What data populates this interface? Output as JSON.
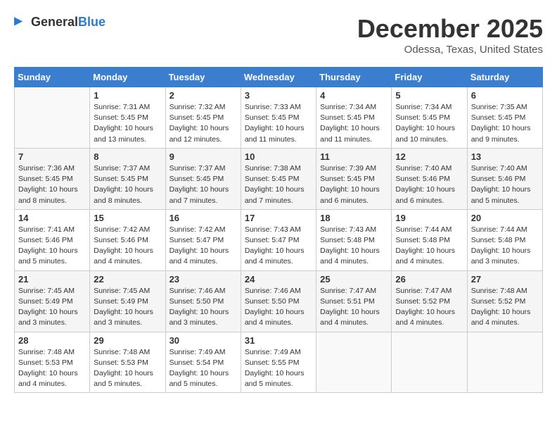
{
  "header": {
    "logo_general": "General",
    "logo_blue": "Blue",
    "month_title": "December 2025",
    "location": "Odessa, Texas, United States"
  },
  "weekdays": [
    "Sunday",
    "Monday",
    "Tuesday",
    "Wednesday",
    "Thursday",
    "Friday",
    "Saturday"
  ],
  "weeks": [
    [
      {
        "day": "",
        "info": ""
      },
      {
        "day": "1",
        "info": "Sunrise: 7:31 AM\nSunset: 5:45 PM\nDaylight: 10 hours\nand 13 minutes."
      },
      {
        "day": "2",
        "info": "Sunrise: 7:32 AM\nSunset: 5:45 PM\nDaylight: 10 hours\nand 12 minutes."
      },
      {
        "day": "3",
        "info": "Sunrise: 7:33 AM\nSunset: 5:45 PM\nDaylight: 10 hours\nand 11 minutes."
      },
      {
        "day": "4",
        "info": "Sunrise: 7:34 AM\nSunset: 5:45 PM\nDaylight: 10 hours\nand 11 minutes."
      },
      {
        "day": "5",
        "info": "Sunrise: 7:34 AM\nSunset: 5:45 PM\nDaylight: 10 hours\nand 10 minutes."
      },
      {
        "day": "6",
        "info": "Sunrise: 7:35 AM\nSunset: 5:45 PM\nDaylight: 10 hours\nand 9 minutes."
      }
    ],
    [
      {
        "day": "7",
        "info": "Sunrise: 7:36 AM\nSunset: 5:45 PM\nDaylight: 10 hours\nand 8 minutes."
      },
      {
        "day": "8",
        "info": "Sunrise: 7:37 AM\nSunset: 5:45 PM\nDaylight: 10 hours\nand 8 minutes."
      },
      {
        "day": "9",
        "info": "Sunrise: 7:37 AM\nSunset: 5:45 PM\nDaylight: 10 hours\nand 7 minutes."
      },
      {
        "day": "10",
        "info": "Sunrise: 7:38 AM\nSunset: 5:45 PM\nDaylight: 10 hours\nand 7 minutes."
      },
      {
        "day": "11",
        "info": "Sunrise: 7:39 AM\nSunset: 5:45 PM\nDaylight: 10 hours\nand 6 minutes."
      },
      {
        "day": "12",
        "info": "Sunrise: 7:40 AM\nSunset: 5:46 PM\nDaylight: 10 hours\nand 6 minutes."
      },
      {
        "day": "13",
        "info": "Sunrise: 7:40 AM\nSunset: 5:46 PM\nDaylight: 10 hours\nand 5 minutes."
      }
    ],
    [
      {
        "day": "14",
        "info": "Sunrise: 7:41 AM\nSunset: 5:46 PM\nDaylight: 10 hours\nand 5 minutes."
      },
      {
        "day": "15",
        "info": "Sunrise: 7:42 AM\nSunset: 5:46 PM\nDaylight: 10 hours\nand 4 minutes."
      },
      {
        "day": "16",
        "info": "Sunrise: 7:42 AM\nSunset: 5:47 PM\nDaylight: 10 hours\nand 4 minutes."
      },
      {
        "day": "17",
        "info": "Sunrise: 7:43 AM\nSunset: 5:47 PM\nDaylight: 10 hours\nand 4 minutes."
      },
      {
        "day": "18",
        "info": "Sunrise: 7:43 AM\nSunset: 5:48 PM\nDaylight: 10 hours\nand 4 minutes."
      },
      {
        "day": "19",
        "info": "Sunrise: 7:44 AM\nSunset: 5:48 PM\nDaylight: 10 hours\nand 4 minutes."
      },
      {
        "day": "20",
        "info": "Sunrise: 7:44 AM\nSunset: 5:48 PM\nDaylight: 10 hours\nand 3 minutes."
      }
    ],
    [
      {
        "day": "21",
        "info": "Sunrise: 7:45 AM\nSunset: 5:49 PM\nDaylight: 10 hours\nand 3 minutes."
      },
      {
        "day": "22",
        "info": "Sunrise: 7:45 AM\nSunset: 5:49 PM\nDaylight: 10 hours\nand 3 minutes."
      },
      {
        "day": "23",
        "info": "Sunrise: 7:46 AM\nSunset: 5:50 PM\nDaylight: 10 hours\nand 3 minutes."
      },
      {
        "day": "24",
        "info": "Sunrise: 7:46 AM\nSunset: 5:50 PM\nDaylight: 10 hours\nand 4 minutes."
      },
      {
        "day": "25",
        "info": "Sunrise: 7:47 AM\nSunset: 5:51 PM\nDaylight: 10 hours\nand 4 minutes."
      },
      {
        "day": "26",
        "info": "Sunrise: 7:47 AM\nSunset: 5:52 PM\nDaylight: 10 hours\nand 4 minutes."
      },
      {
        "day": "27",
        "info": "Sunrise: 7:48 AM\nSunset: 5:52 PM\nDaylight: 10 hours\nand 4 minutes."
      }
    ],
    [
      {
        "day": "28",
        "info": "Sunrise: 7:48 AM\nSunset: 5:53 PM\nDaylight: 10 hours\nand 4 minutes."
      },
      {
        "day": "29",
        "info": "Sunrise: 7:48 AM\nSunset: 5:53 PM\nDaylight: 10 hours\nand 5 minutes."
      },
      {
        "day": "30",
        "info": "Sunrise: 7:49 AM\nSunset: 5:54 PM\nDaylight: 10 hours\nand 5 minutes."
      },
      {
        "day": "31",
        "info": "Sunrise: 7:49 AM\nSunset: 5:55 PM\nDaylight: 10 hours\nand 5 minutes."
      },
      {
        "day": "",
        "info": ""
      },
      {
        "day": "",
        "info": ""
      },
      {
        "day": "",
        "info": ""
      }
    ]
  ]
}
